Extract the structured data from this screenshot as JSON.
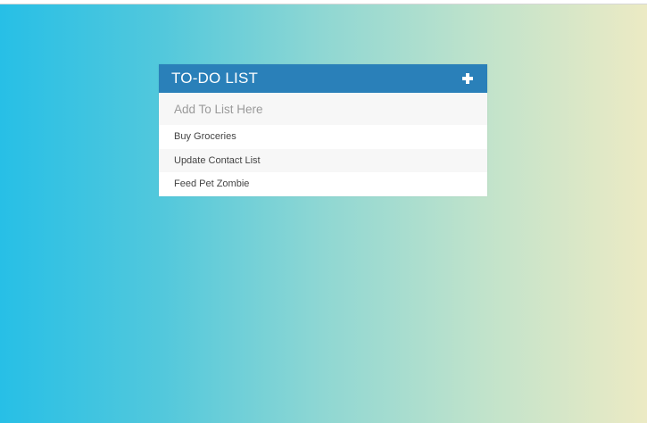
{
  "todo": {
    "title": "TO-DO LIST",
    "add_icon": "plus-icon",
    "input": {
      "placeholder": "Add To List Here",
      "value": ""
    },
    "items": [
      {
        "label": "Buy Groceries"
      },
      {
        "label": "Update Contact List"
      },
      {
        "label": "Feed Pet Zombie"
      }
    ]
  },
  "colors": {
    "header": "#2a80b9",
    "gradient_start": "#27bfe6",
    "gradient_end": "#eceac4"
  }
}
